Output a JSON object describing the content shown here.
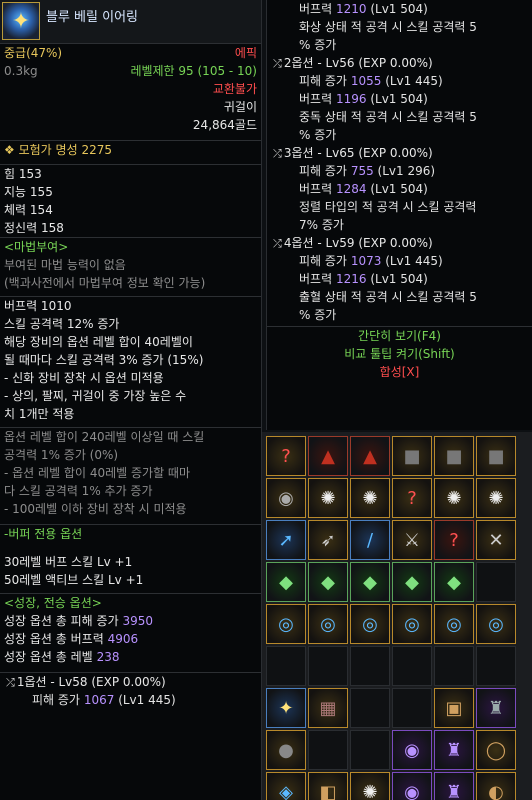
{
  "tooltip_left": {
    "item_name": "블루 베릴 이어링",
    "grade": "중급(47%)",
    "rarity": "에픽",
    "weight": "0.3kg",
    "level_limit": "레벨제한 95 (105 - 10)",
    "trade": "교환불가",
    "slot": "귀걸이",
    "price": "24,864골드",
    "adventurer_fame_label": "모험가 명성",
    "adventurer_fame_value": "2275",
    "stats": [
      {
        "label": "힘",
        "value": "153"
      },
      {
        "label": "지능",
        "value": "155"
      },
      {
        "label": "체력",
        "value": "154"
      },
      {
        "label": "정신력",
        "value": "158"
      }
    ],
    "magic_enchant": {
      "title": "<마법부여>",
      "none": "부여된 마법 능력이 없음",
      "hint": "(백과사전에서 마법부여 정보 확인 가능)"
    },
    "main_effects": [
      "버프력 1010",
      "스킬 공격력 12% 증가",
      "해당 장비의 옵션 레벨 합이 40레벨이",
      "될 때마다 스킬 공격력 3% 증가 (15%)",
      "- 신화 장비 장착 시 옵션 미적용",
      "- 상의, 팔찌, 귀걸이 중 가장 높은 수",
      "치 1개만 적용"
    ],
    "inactive_effects": [
      "옵션 레벨 합이 240레벨 이상일 때 스킬",
      "공격력 1% 증가 (0%)",
      "- 옵션 레벨 합이 40레벨 증가할 때마",
      "다 스킬 공격력 1% 추가 증가",
      "- 100레벨 이하 장비 장착 시 미적용"
    ],
    "buffer_title": "-버퍼 전용 옵션",
    "buffer_lines": [
      "30레벨 버프 스킬 Lv +1",
      "50레벨 액티브 스킬 Lv +1"
    ],
    "growth_title": "<성장, 전승 옵션>",
    "growth_lines": [
      {
        "label": "성장 옵션 총 피해 증가",
        "value": "3950"
      },
      {
        "label": "성장 옵션 총 버프력",
        "value": "4906"
      },
      {
        "label": "성장 옵션 총 레벨",
        "value": "238"
      }
    ],
    "option1": {
      "head": "1옵션 - Lv58 (EXP 0.00%)",
      "line1_label": "피해 증가",
      "line1_value": "1067",
      "line1_sub": "(Lv1 445)"
    }
  },
  "tooltip_right": {
    "top_lines": [
      {
        "label": "버프력",
        "value": "1210",
        "sub": "(Lv1 504)"
      },
      {
        "text": "화상 상태 적 공격 시 스킬 공격력 5"
      },
      {
        "text": "% 증가"
      }
    ],
    "options": [
      {
        "head": "2옵션 - Lv56 (EXP 0.00%)",
        "lines": [
          {
            "label": "피해 증가",
            "value": "1055",
            "sub": "(Lv1 445)"
          },
          {
            "label": "버프력",
            "value": "1196",
            "sub": "(Lv1 504)"
          }
        ],
        "desc1": "중독 상태 적 공격 시 스킬 공격력 5",
        "desc2": "% 증가"
      },
      {
        "head": "3옵션 - Lv65 (EXP 0.00%)",
        "lines": [
          {
            "label": "피해 증가",
            "value": "755",
            "sub": "(Lv1 296)"
          },
          {
            "label": "버프력",
            "value": "1284",
            "sub": "(Lv1 504)"
          }
        ],
        "desc1": "정렬 타입의 적 공격 시 스킬 공격력",
        "desc2": "7% 증가"
      },
      {
        "head": "4옵션 - Lv59 (EXP 0.00%)",
        "lines": [
          {
            "label": "피해 증가",
            "value": "1073",
            "sub": "(Lv1 445)"
          },
          {
            "label": "버프력",
            "value": "1216",
            "sub": "(Lv1 504)"
          }
        ],
        "desc1": "출혈 상태 적 공격 시 스킬 공격력 5",
        "desc2": "% 증가"
      }
    ],
    "footer": {
      "simple_view": "간단히 보기(F4)",
      "compare": "비교 툴팁 켜기(Shift)",
      "synthesis": "합성[X]"
    }
  },
  "colors": {
    "gold": "#e7c65b",
    "epic": "#ff4d4d",
    "green": "#77d455",
    "purple": "#b892ff"
  }
}
